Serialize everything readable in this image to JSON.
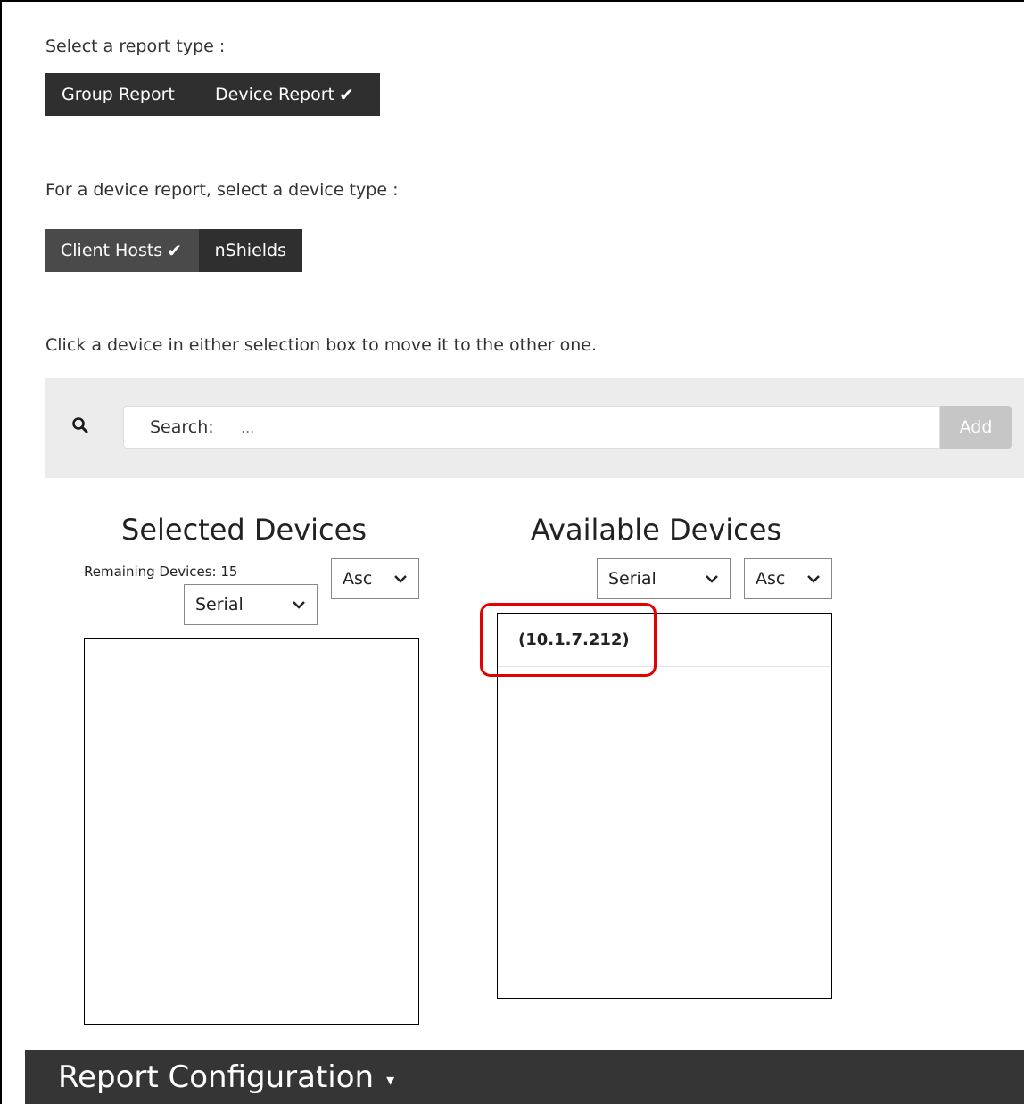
{
  "report_type": {
    "label": "Select a report type :",
    "options": [
      "Group Report",
      "Device Report"
    ],
    "selected": "Device Report",
    "check": "✔"
  },
  "device_type": {
    "label": "For a device report, select a device type :",
    "options": [
      "Client Hosts",
      "nShields"
    ],
    "selected": "Client Hosts",
    "check": "✔"
  },
  "instruction": "Click a device in either selection box to move it to the other one.",
  "search": {
    "label": "Search:",
    "placeholder": "...",
    "add_label": "Add"
  },
  "selected_devices": {
    "title": "Selected Devices",
    "remaining": "Remaining Devices: 15",
    "sort_field": "Serial",
    "sort_order": "Asc",
    "items": []
  },
  "available_devices": {
    "title": "Available Devices",
    "sort_field": "Serial",
    "sort_order": "Asc",
    "items": [
      "(10.1.7.212)"
    ]
  },
  "report_configuration": {
    "label": "Report Configuration",
    "caret": "▾"
  },
  "colors": {
    "dark_button": "#2f2f2f",
    "active_button": "#4a4a4a",
    "highlight": "#e30000",
    "add_button": "#c6c6c6"
  }
}
